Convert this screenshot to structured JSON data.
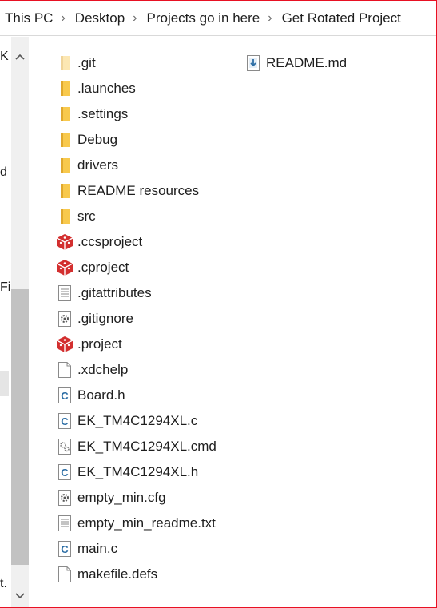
{
  "breadcrumb": {
    "items": [
      "This PC",
      "Desktop",
      "Projects go in here",
      "Get Rotated Project"
    ],
    "separator": "›"
  },
  "nav_fragments": [
    "K",
    "d",
    "Fi",
    "t."
  ],
  "files": [
    {
      "name": ".git",
      "icon": "folder-faded"
    },
    {
      "name": ".launches",
      "icon": "folder"
    },
    {
      "name": ".settings",
      "icon": "folder"
    },
    {
      "name": "Debug",
      "icon": "folder"
    },
    {
      "name": "drivers",
      "icon": "folder"
    },
    {
      "name": "README resources",
      "icon": "folder"
    },
    {
      "name": "src",
      "icon": "folder"
    },
    {
      "name": ".ccsproject",
      "icon": "eclipse-project"
    },
    {
      "name": ".cproject",
      "icon": "eclipse-project"
    },
    {
      "name": ".gitattributes",
      "icon": "text-file"
    },
    {
      "name": ".gitignore",
      "icon": "gear-file"
    },
    {
      "name": ".project",
      "icon": "eclipse-project"
    },
    {
      "name": ".xdchelp",
      "icon": "blank-file"
    },
    {
      "name": "Board.h",
      "icon": "c-file"
    },
    {
      "name": "EK_TM4C1294XL.c",
      "icon": "c-file"
    },
    {
      "name": "EK_TM4C1294XL.cmd",
      "icon": "cmd-file"
    },
    {
      "name": "EK_TM4C1294XL.h",
      "icon": "c-file"
    },
    {
      "name": "empty_min.cfg",
      "icon": "gear-file"
    },
    {
      "name": "empty_min_readme.txt",
      "icon": "text-file"
    },
    {
      "name": "main.c",
      "icon": "c-file"
    },
    {
      "name": "makefile.defs",
      "icon": "blank-file"
    },
    {
      "name": "README.md",
      "icon": "md-file"
    }
  ],
  "colors": {
    "accent_frame": "#e81123",
    "folder": "#f8c94d",
    "eclipse": "#d32f2f",
    "c_icon": "#2d6ea5"
  }
}
